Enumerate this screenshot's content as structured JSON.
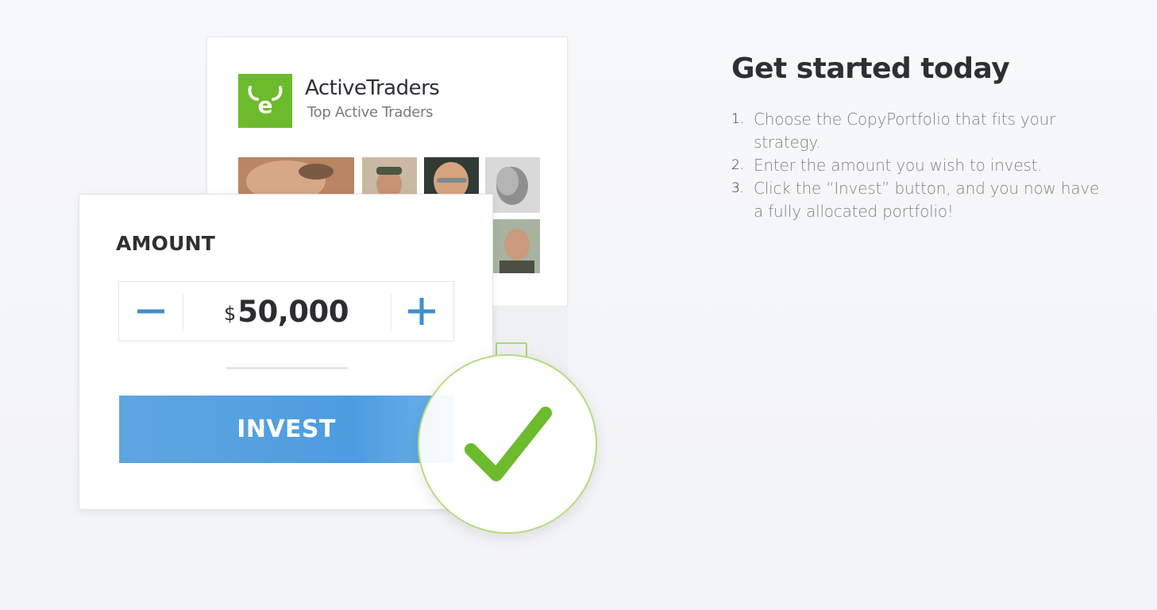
{
  "portfolio_card": {
    "name": "ActiveTraders",
    "subtitle": "Top Active Traders",
    "logo_icon": "etoro-bull-e-icon",
    "brand_color": "#6cbb2c",
    "trader_avatars_count": 6
  },
  "amount_card": {
    "label": "AMOUNT",
    "currency_symbol": "$",
    "amount": "50,000",
    "decrement_icon": "minus-icon",
    "increment_icon": "plus-icon",
    "invest_label": "INVEST",
    "accent_color": "#4d9ce0"
  },
  "confirmation": {
    "icon": "checkmark-icon",
    "color": "#6cbb2c"
  },
  "get_started": {
    "heading": "Get started today",
    "steps": [
      {
        "number": "1.",
        "text": "Choose the CopyPortfolio that fits your strategy."
      },
      {
        "number": "2.",
        "text": "Enter the amount you wish to invest."
      },
      {
        "number": "3.",
        "text": "Click the “Invest” button, and you now have a fully allocated portfolio!"
      }
    ]
  }
}
